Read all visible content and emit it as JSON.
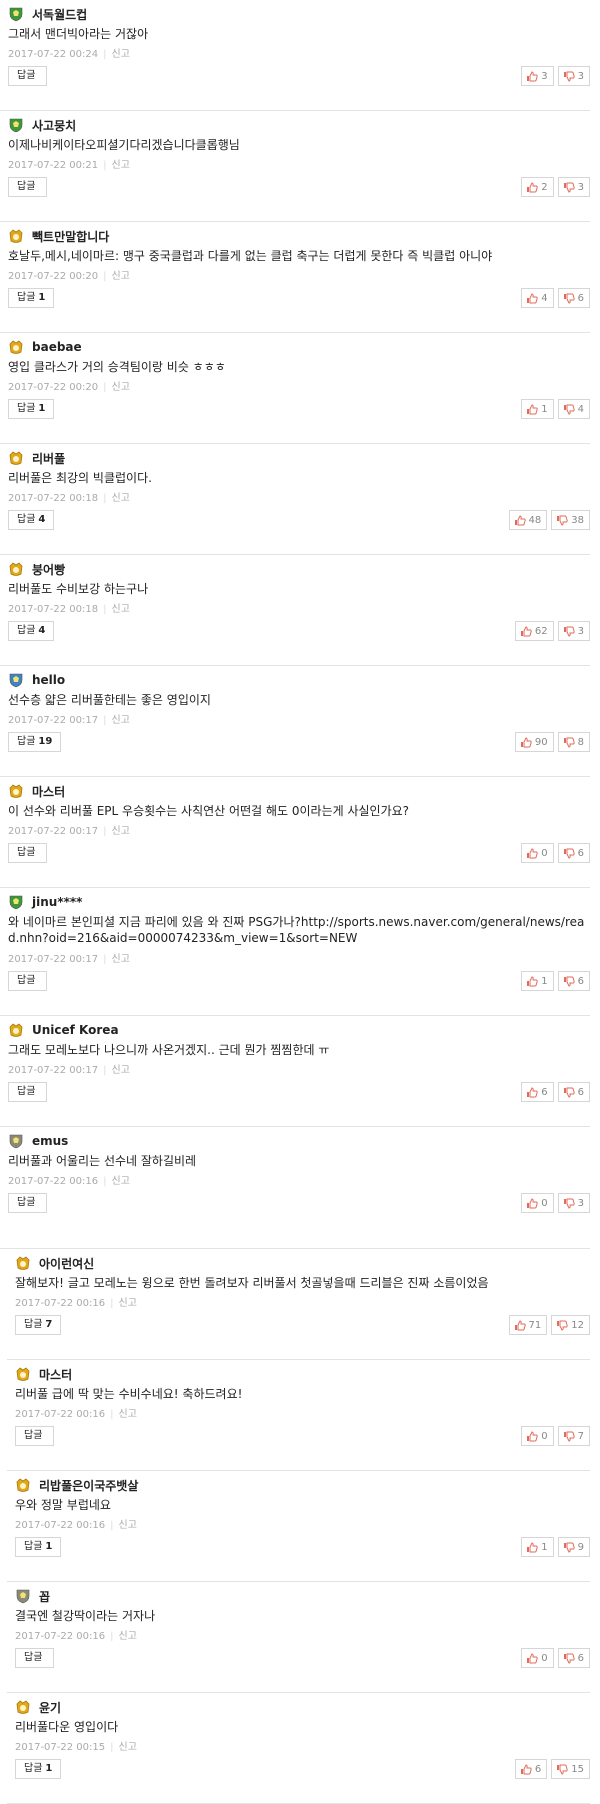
{
  "labels": {
    "report": "신고",
    "reply": "답글",
    "like_icon": "thumbs-up-icon",
    "dislike_icon": "thumbs-down-icon"
  },
  "colors": {
    "badge_green": "#3a9a3a",
    "badge_gold": "#e0a81a",
    "badge_blue": "#3d84c6",
    "badge_gray": "#8a8a7a",
    "like_red": "#e26a5a"
  },
  "comments": [
    {
      "badge": "green",
      "nickname": "서독월드컵",
      "text": "그래서 맨더빅아라는 거잖아",
      "date": "2017-07-22 00:24",
      "replies": "",
      "likes": "3",
      "dislikes": "3"
    },
    {
      "badge": "green",
      "nickname": "사고뭉치",
      "text": "이제나비케이타오피셜기다리겠습니다클롭행님",
      "date": "2017-07-22 00:21",
      "replies": "",
      "likes": "2",
      "dislikes": "3"
    },
    {
      "badge": "gold",
      "nickname": "빽트만말합니다",
      "text": "호날두,메시,네이마르: 맹구 중국클럽과 다를게 없는 클럽 축구는 더럽게 못한다 즉 빅클럽 아니야",
      "date": "2017-07-22 00:20",
      "replies": "1",
      "likes": "4",
      "dislikes": "6"
    },
    {
      "badge": "gold",
      "nickname": "baebae",
      "text": "영입 클라스가 거의 승격팀이랑 비슷 ㅎㅎㅎ",
      "date": "2017-07-22 00:20",
      "replies": "1",
      "likes": "1",
      "dislikes": "4"
    },
    {
      "badge": "gold",
      "nickname": "리버풀",
      "text": "리버풀은 최강의 빅클럽이다.",
      "date": "2017-07-22 00:18",
      "replies": "4",
      "likes": "48",
      "dislikes": "38"
    },
    {
      "badge": "gold",
      "nickname": "붕어빵",
      "text": "리버풀도 수비보강 하는구나",
      "date": "2017-07-22 00:18",
      "replies": "4",
      "likes": "62",
      "dislikes": "3"
    },
    {
      "badge": "blue",
      "nickname": "hello",
      "text": "선수층 얇은 리버풀한테는 좋은 영입이지",
      "date": "2017-07-22 00:17",
      "replies": "19",
      "likes": "90",
      "dislikes": "8"
    },
    {
      "badge": "gold",
      "nickname": "마스터",
      "text": "이 선수와 리버풀 EPL 우승횟수는 사칙연산 어떤걸 해도 0이라는게 사실인가요?",
      "date": "2017-07-22 00:17",
      "replies": "",
      "likes": "0",
      "dislikes": "6"
    },
    {
      "badge": "green",
      "nickname": "jinu****",
      "text": "와 네이마르 본인피셜 지금 파리에 있음 와 진짜 PSG가나?http://sports.news.naver.com/general/news/read.nhn?oid=216&aid=0000074233&m_view=1&sort=NEW",
      "date": "2017-07-22 00:17",
      "replies": "",
      "likes": "1",
      "dislikes": "6",
      "tall": true
    },
    {
      "badge": "gold",
      "nickname": "Unicef Korea",
      "text": "그래도 모레노보다 나으니까 사온거겠지.. 근데 뭔가 찜찜한데 ㅠ",
      "date": "2017-07-22 00:17",
      "replies": "",
      "likes": "6",
      "dislikes": "6"
    },
    {
      "badge": "gray",
      "nickname": "emus",
      "text": "리버풀과 어울리는 선수네 잘하길비레",
      "date": "2017-07-22 00:16",
      "replies": "",
      "likes": "0",
      "dislikes": "3",
      "extra": true
    },
    {
      "badge": "gold",
      "nickname": "아이런여신",
      "text": "잘해보자! 글고 모레노는 윙으로 한번 돌려보자 리버풀서 첫골넣을때 드리블은 진짜 소름이었음",
      "date": "2017-07-22 00:16",
      "replies": "7",
      "likes": "71",
      "dislikes": "12",
      "reply": true
    },
    {
      "badge": "gold",
      "nickname": "마스터",
      "text": "리버풀 급에 딱 맞는 수비수네요! 축하드려요!",
      "date": "2017-07-22 00:16",
      "replies": "",
      "likes": "0",
      "dislikes": "7",
      "reply": true
    },
    {
      "badge": "gold",
      "nickname": "리밥풀은이국주뱃살",
      "text": "우와 정말 부럽네요",
      "date": "2017-07-22 00:16",
      "replies": "1",
      "likes": "1",
      "dislikes": "9",
      "reply": true
    },
    {
      "badge": "gray",
      "nickname": "꼽",
      "text": "결국엔 철강딱이라는 거자나",
      "date": "2017-07-22 00:16",
      "replies": "",
      "likes": "0",
      "dislikes": "6",
      "reply": true
    },
    {
      "badge": "gold",
      "nickname": "윤기",
      "text": "리버풀다운 영입이다",
      "date": "2017-07-22 00:15",
      "replies": "1",
      "likes": "6",
      "dislikes": "15",
      "reply": true
    }
  ]
}
